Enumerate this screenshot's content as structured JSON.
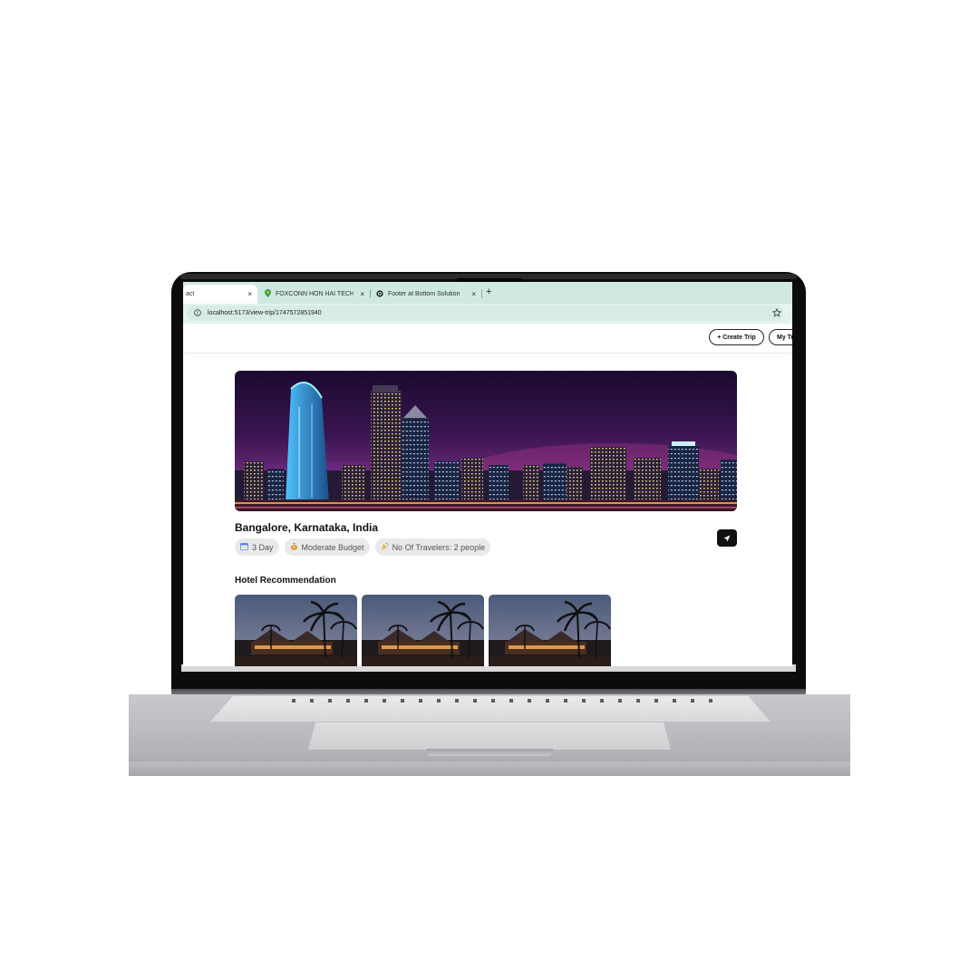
{
  "browser": {
    "tabs": [
      {
        "label": "act",
        "active": true
      },
      {
        "label": "FOXCONN HON HAI TECHNOLOGY",
        "active": false
      },
      {
        "label": "Footer at Bottom Solution",
        "active": false
      }
    ],
    "new_tab": "+",
    "close": "×",
    "url": "localhost:5173/view-trip/1747572851940"
  },
  "header": {
    "create_trip": "+ Create Trip",
    "my_trips": "My Trips"
  },
  "trip": {
    "location": "Bangalore, Karnataka, India",
    "chips": {
      "days": "3 Day",
      "budget": "Moderate Budget",
      "travelers": "No Of Travelers: 2 people"
    }
  },
  "hotels": {
    "title": "Hotel Recommendation"
  }
}
